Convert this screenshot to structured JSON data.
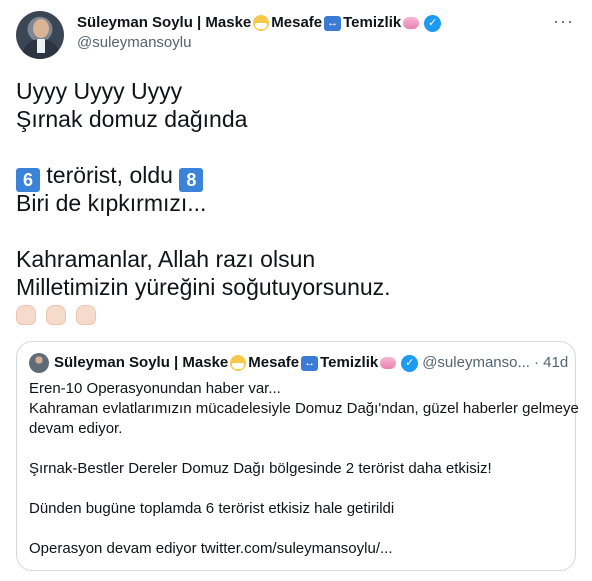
{
  "author": {
    "name": "Süleyman Soylu | Maske",
    "word_mesafe": "Mesafe",
    "word_temizlik": "Temizlik",
    "handle": "@suleymansoylu",
    "more_label": "···",
    "verified_icon": "verified-badge-icon",
    "verified_glyph": "✓",
    "arrow_glyph": "↔"
  },
  "tweet": {
    "line1": "Uyyy Uyyy Uyyy",
    "line2": "Şırnak domuz dağında",
    "num_left": "6",
    "line3_middle": " terörist, oldu ",
    "num_right": "8",
    "line4": "Biri de kıpkırmızı...",
    "line5": "Kahramanlar, Allah razı olsun",
    "line6": "Milletimizin yüreğini soğutuyorsunuz.",
    "reaction_icons": [
      "pray-hands-icon",
      "pray-hands-icon",
      "pray-hands-icon"
    ]
  },
  "quoted": {
    "name": "Süleyman Soylu | Maske",
    "word_mesafe": "Mesafe",
    "word_temizlik": "Temizlik",
    "handle": "@suleymanso...",
    "time": "· 41d",
    "lines": [
      "Eren-10 Operasyonundan haber var...",
      "Kahraman evlatlarımızın mücadelesiyle Domuz Dağı'ndan, güzel haberler gelmeye",
      "devam ediyor.",
      "",
      "Şırnak-Bestler Dereler Domuz Dağı bölgesinde 2 terörist daha etkisiz!",
      "",
      "Dünden bugüne toplamda 6 terörist etkisiz hale getirildi",
      "",
      "Operasyon devam ediyor twitter.com/suleymansoylu/..."
    ]
  },
  "colors": {
    "text": "#0f1419",
    "secondary": "#536471",
    "verified": "#1d9bf0",
    "border": "#cfd9de",
    "number_badge": "#3b82d9"
  }
}
